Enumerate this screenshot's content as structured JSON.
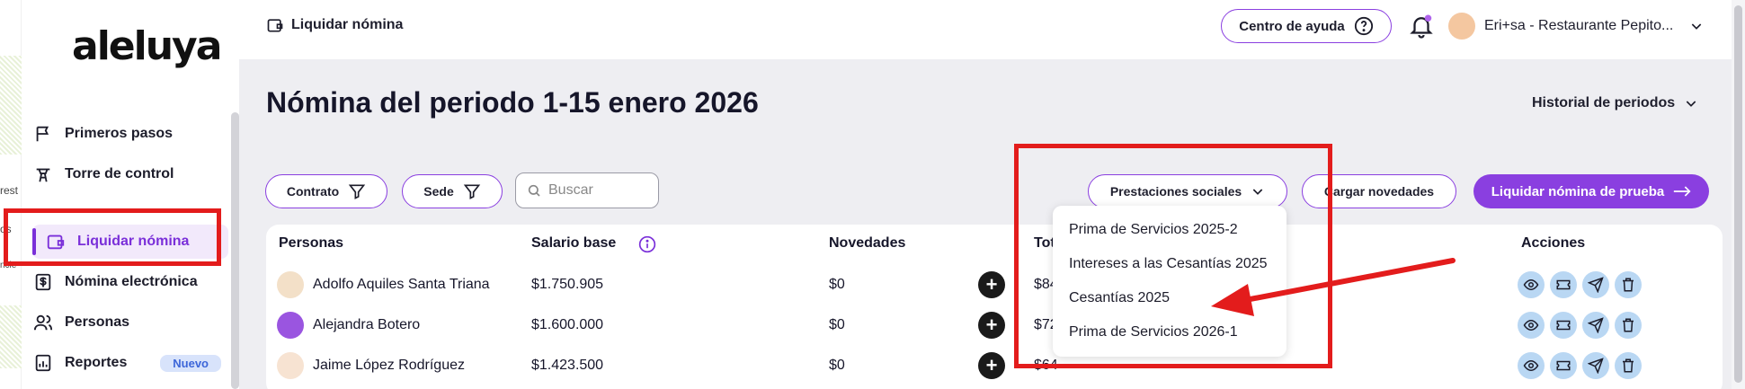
{
  "left_strip": {
    "texts": [
      "rest",
      "os",
      "ncie"
    ]
  },
  "sidebar": {
    "logo": "aleluya",
    "items": [
      {
        "label": "Primeros pasos",
        "icon": "flag-icon"
      },
      {
        "label": "Torre de control",
        "icon": "tower-icon"
      },
      {
        "label": "Liquidar nómina",
        "icon": "wallet-icon",
        "active": true
      },
      {
        "label": "Nómina electrónica",
        "icon": "dollar-doc-icon"
      },
      {
        "label": "Personas",
        "icon": "people-icon"
      },
      {
        "label": "Reportes",
        "icon": "chart-icon",
        "badge": "Nuevo"
      }
    ]
  },
  "topbar": {
    "title": "Liquidar nómina",
    "help_label": "Centro de ayuda",
    "user_label": "Eri+sa - Restaurante Pepito..."
  },
  "main": {
    "page_title": "Nómina del periodo 1-15 enero 2026",
    "history_label": "Historial de periodos",
    "filters": {
      "contrato": "Contrato",
      "sede": "Sede",
      "search_placeholder": "Buscar"
    },
    "prestaciones_label": "Prestaciones sociales",
    "cargar_label": "Cargar novedades",
    "primary_label": "Liquidar nómina de prueba"
  },
  "table": {
    "headers": {
      "personas": "Personas",
      "salario": "Salario base",
      "novedades": "Novedades",
      "total": "Tot",
      "acciones": "Acciones"
    },
    "rows": [
      {
        "name": "Adolfo Aquiles Santa Triana",
        "salary": "$1.750.905",
        "novedades": "$0",
        "total": "$84"
      },
      {
        "name": "Alejandra Botero",
        "salary": "$1.600.000",
        "novedades": "$0",
        "total": "$72"
      },
      {
        "name": "Jaime López Rodríguez",
        "salary": "$1.423.500",
        "novedades": "$0",
        "total": "$64"
      }
    ]
  },
  "dropdown": {
    "items": [
      "Prima de Servicios 2025-2",
      "Intereses a las Cesantías 2025",
      "Cesantías 2025",
      "Prima de Servicios 2026-1"
    ]
  },
  "colors": {
    "accent": "#8a3fe0",
    "annotation": "#e31c1c",
    "action_bg": "#b9d7f3",
    "main_bg": "#eeeef2"
  }
}
